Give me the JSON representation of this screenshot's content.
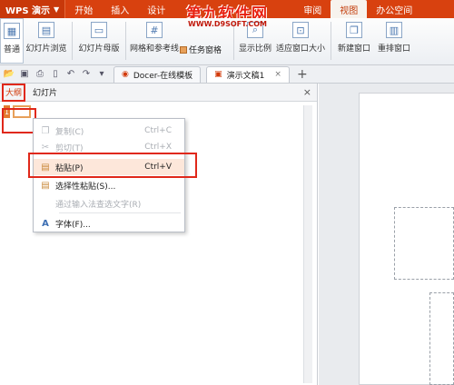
{
  "app": {
    "name": "WPS 演示"
  },
  "menu_tabs": [
    "开始",
    "插入",
    "设计",
    "审阅",
    "视图",
    "办公空间"
  ],
  "watermark": {
    "logo": "第九软件网",
    "url": "WWW.D9SOFT.COM"
  },
  "ribbon": {
    "normal": "普通",
    "slide_sorter": "幻灯片浏览",
    "slide_master": "幻灯片母版",
    "grid": "网格和参考线",
    "task_pane": "任务窗格",
    "zoom": "显示比例",
    "fit_window": "适应窗口大小",
    "new_window": "新建窗口",
    "arrange": "重排窗口"
  },
  "doc_tabs": [
    {
      "label": "Docer-在线模板"
    },
    {
      "label": "演示文稿1"
    }
  ],
  "panel": {
    "outline_tab": "大纲",
    "slides_tab": "幻灯片",
    "slide_number": "1"
  },
  "context_menu": {
    "copy": {
      "label": "复制(C)",
      "shortcut": "Ctrl+C"
    },
    "cut": {
      "label": "剪切(T)",
      "shortcut": "Ctrl+X"
    },
    "paste": {
      "label": "粘贴(P)",
      "shortcut": "Ctrl+V"
    },
    "paste_special": {
      "label": "选择性粘贴(S)..."
    },
    "search_text": {
      "label": "通过输入法查选文字(R)"
    },
    "font": {
      "label": "字体(F)..."
    }
  },
  "colors": {
    "brand": "#d8410f",
    "highlight": "#e0281a",
    "hover": "#fde7da"
  }
}
